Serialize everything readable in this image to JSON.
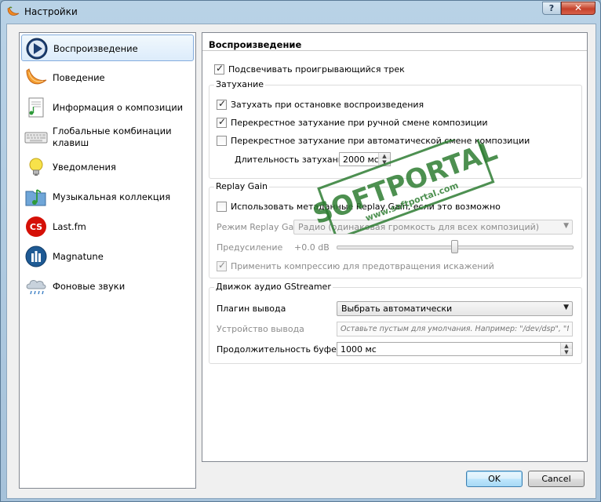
{
  "window": {
    "title": "Настройки",
    "help_label": "?",
    "close_label": "✕"
  },
  "sidebar": {
    "items": [
      {
        "label": "Воспроизведение",
        "icon": "play-icon",
        "active": true
      },
      {
        "label": "Поведение",
        "icon": "clementine-icon"
      },
      {
        "label": "Информация о композиции",
        "icon": "document-music-icon"
      },
      {
        "label": "Глобальные комбинации клавиш",
        "icon": "keyboard-icon"
      },
      {
        "label": "Уведомления",
        "icon": "lightbulb-icon"
      },
      {
        "label": "Музыкальная коллекция",
        "icon": "music-folder-icon"
      },
      {
        "label": "Last.fm",
        "icon": "lastfm-icon"
      },
      {
        "label": "Magnatune",
        "icon": "magnatune-icon"
      },
      {
        "label": "Фоновые звуки",
        "icon": "cloud-rain-icon"
      }
    ]
  },
  "page": {
    "title": "Воспроизведение",
    "highlight_track": {
      "label": "Подсвечивать проигрывающийся трек",
      "checked": true
    },
    "fadeout": {
      "title": "Затухание",
      "stop_fade": {
        "label": "Затухать при остановке воспроизведения",
        "checked": true
      },
      "manual_crossfade": {
        "label": "Перекрестное затухание при ручной смене композиции",
        "checked": true
      },
      "auto_crossfade": {
        "label": "Перекрестное затухание при автоматической смене композиции",
        "checked": false
      },
      "duration_label": "Длительность затухания",
      "duration_value": "2000 мс"
    },
    "replaygain": {
      "title": "Replay Gain",
      "use_metadata": {
        "label": "Использовать метаданные Replay Gain, если это возможно",
        "checked": false
      },
      "mode_label": "Режим Replay Gain",
      "mode_value": "Радио (одинаковая громкость для всех композиций)",
      "preamp_label": "Предусиление",
      "preamp_value": "+0.0 dB",
      "preamp_level": 0.5,
      "compression": {
        "label": "Применить компрессию для предотвращения искажений",
        "checked": true
      }
    },
    "gstreamer": {
      "title": "Движок аудио GStreamer",
      "output_plugin_label": "Плагин вывода",
      "output_plugin_value": "Выбрать автоматически",
      "output_device_label": "Устройство вывода",
      "output_device_placeholder": "Оставьте пустым для умолчания. Например: \"/dev/dsp\", \"front\", и т.д.",
      "buffer_label": "Продолжительность буфера",
      "buffer_value": "1000 мс"
    }
  },
  "buttons": {
    "ok": "OK",
    "cancel": "Cancel"
  },
  "colors": {
    "accent": "#3c7fb1",
    "selection": "#dcecfb",
    "watermark": "#2e7d32"
  }
}
